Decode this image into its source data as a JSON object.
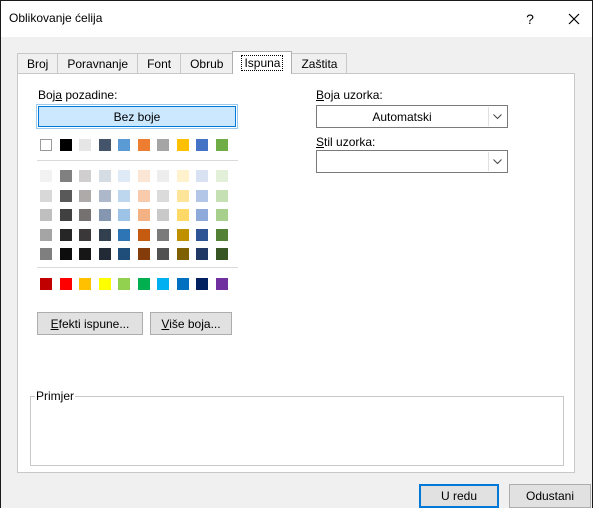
{
  "window": {
    "title": "Oblikovanje ćelija",
    "help_glyph": "?"
  },
  "tabs": [
    {
      "label": "Broj"
    },
    {
      "label": "Poravnanje"
    },
    {
      "label": "Font"
    },
    {
      "label": "Obrub"
    },
    {
      "label": "Ispuna",
      "active": true
    },
    {
      "label": "Zaštita"
    }
  ],
  "background": {
    "label_pre": "Boj",
    "label_accel": "a",
    "label_post": " pozadine:",
    "no_color_label": "Bez boje",
    "theme_top_row": [
      "#ffffff",
      "#000000",
      "#e7e6e6",
      "#44546a",
      "#5b9bd5",
      "#ed7d31",
      "#a5a5a5",
      "#ffc000",
      "#4472c4",
      "#70ad47"
    ],
    "theme_shades": [
      [
        "#f2f2f2",
        "#808080",
        "#d0cece",
        "#d6dce4",
        "#deebf6",
        "#fbe5d5",
        "#ededed",
        "#fff2cc",
        "#d9e2f3",
        "#e2efd9"
      ],
      [
        "#d8d8d8",
        "#595959",
        "#aeaaaa",
        "#adb9ca",
        "#bdd7ee",
        "#f8cbad",
        "#dbdbdb",
        "#ffe599",
        "#b4c6e7",
        "#c5e0b3"
      ],
      [
        "#bfbfbf",
        "#404040",
        "#757171",
        "#8496b0",
        "#9dc3e6",
        "#f4b183",
        "#c9c9c9",
        "#ffd966",
        "#8eaadb",
        "#a8d08d"
      ],
      [
        "#a5a5a5",
        "#262626",
        "#3a3838",
        "#323f4f",
        "#2e75b5",
        "#c55a11",
        "#7b7b7b",
        "#bf9000",
        "#2f5496",
        "#538135"
      ],
      [
        "#7f7f7f",
        "#0d0d0d",
        "#171616",
        "#222a35",
        "#1e4e79",
        "#843c0b",
        "#525252",
        "#7f6000",
        "#1f3864",
        "#375623"
      ]
    ],
    "standard_colors": [
      "#c00000",
      "#ff0000",
      "#ffc000",
      "#ffff00",
      "#92d050",
      "#00b050",
      "#00b0f0",
      "#0070c0",
      "#002060",
      "#7030a0"
    ],
    "fill_effects_accel": "E",
    "fill_effects_rest": "fekti ispune...",
    "more_colors_accel": "V",
    "more_colors_rest": "iše boja..."
  },
  "pattern": {
    "color_accel": "B",
    "color_rest": "oja uzorka:",
    "color_value": "Automatski",
    "style_accel": "S",
    "style_rest": "til uzorka:",
    "style_value": ""
  },
  "sample": {
    "label": "Primjer"
  },
  "footer": {
    "ok_label": "U redu",
    "cancel_label": "Odustani"
  }
}
